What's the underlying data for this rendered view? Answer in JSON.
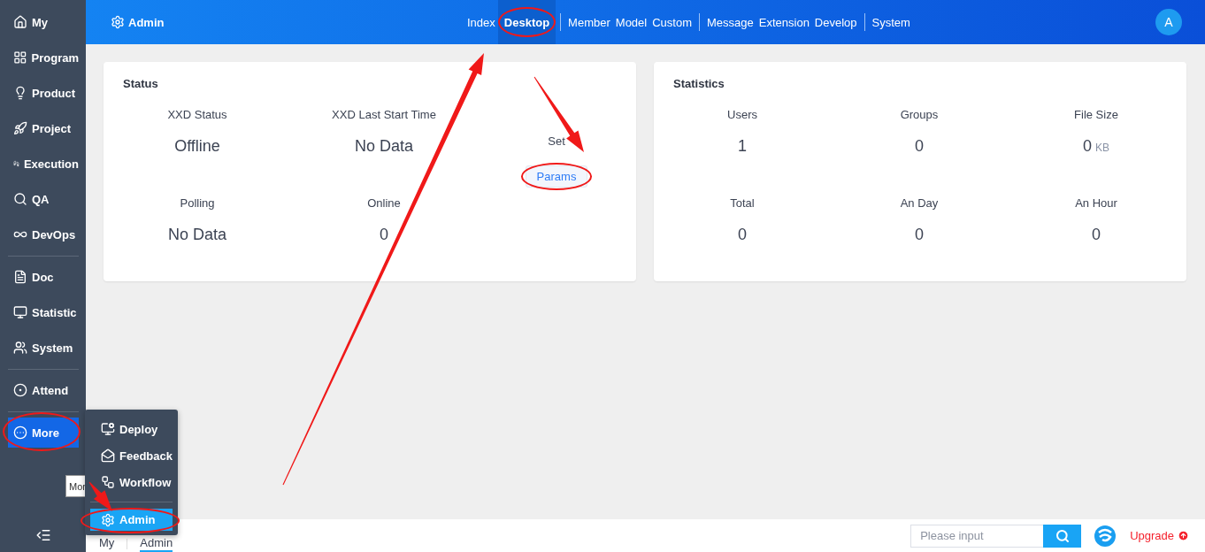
{
  "sidebar": {
    "groups": [
      [
        {
          "label": "My",
          "selected": false
        },
        {
          "label": "Program",
          "selected": false
        },
        {
          "label": "Product",
          "selected": false
        },
        {
          "label": "Project",
          "selected": false
        },
        {
          "label": "Execution",
          "selected": false
        },
        {
          "label": "QA",
          "selected": false
        },
        {
          "label": "DevOps",
          "selected": false
        }
      ],
      [
        {
          "label": "Doc",
          "selected": false
        },
        {
          "label": "Statistic",
          "selected": false
        },
        {
          "label": "System",
          "selected": false
        }
      ],
      [
        {
          "label": "Attend",
          "selected": false
        }
      ],
      [
        {
          "label": "More",
          "selected": true,
          "circled": true
        }
      ]
    ]
  },
  "tooltip": "Mor",
  "more_menu": {
    "items": [
      {
        "label": "Deploy",
        "selected": false,
        "circled": false
      },
      {
        "label": "Feedback",
        "selected": false,
        "circled": false
      },
      {
        "label": "Workflow",
        "selected": false,
        "circled": false
      }
    ],
    "footer_item": {
      "label": "Admin",
      "selected": true,
      "circled": true
    }
  },
  "header": {
    "title": "Admin",
    "nav_groups": [
      [
        {
          "label": "Index",
          "selected": false,
          "circled": false
        },
        {
          "label": "Desktop",
          "selected": true,
          "circled": true
        }
      ],
      [
        {
          "label": "Member",
          "selected": false,
          "circled": false
        },
        {
          "label": "Model",
          "selected": false,
          "circled": false
        },
        {
          "label": "Custom",
          "selected": false,
          "circled": false
        }
      ],
      [
        {
          "label": "Message",
          "selected": false,
          "circled": false
        },
        {
          "label": "Extension",
          "selected": false,
          "circled": false
        },
        {
          "label": "Develop",
          "selected": false,
          "circled": false
        }
      ],
      [
        {
          "label": "System",
          "selected": false,
          "circled": false
        }
      ]
    ],
    "avatar": "A"
  },
  "status_card": {
    "title": "Status",
    "stats": [
      {
        "label": "XXD Status",
        "value": "Offline"
      },
      {
        "label": "XXD Last Start Time",
        "value": "No Data"
      },
      {
        "label": "Polling",
        "value": "No Data"
      },
      {
        "label": "Online",
        "value": "0"
      }
    ],
    "set": {
      "label": "Set",
      "button": "Params",
      "circled": true
    }
  },
  "statistics_card": {
    "title": "Statistics",
    "stats": [
      {
        "label": "Users",
        "value": "1"
      },
      {
        "label": "Groups",
        "value": "0"
      },
      {
        "label": "File Size",
        "value": "0",
        "unit": "KB"
      },
      {
        "label": "Total",
        "value": "0"
      },
      {
        "label": "An Day",
        "value": "0"
      },
      {
        "label": "An Hour",
        "value": "0"
      }
    ]
  },
  "footer": {
    "tabs": [
      {
        "label": "My",
        "selected": false
      },
      {
        "label": "Admin",
        "selected": true
      }
    ],
    "search": {
      "placeholder": "Please input"
    },
    "upgrade": "Upgrade"
  }
}
